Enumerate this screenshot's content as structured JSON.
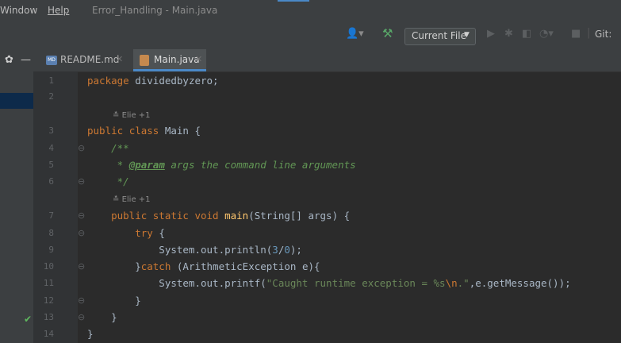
{
  "menu": {
    "window": "Window",
    "help": "Help",
    "title": "Error_Handling - Main.java"
  },
  "toolbar": {
    "run_config": "Current File",
    "git": "Git:"
  },
  "tabs": [
    {
      "label": "README.md"
    },
    {
      "label": "Main.java"
    }
  ],
  "hints": {
    "author1": "Elie +1",
    "author2": "Elie +1"
  },
  "line_numbers": [
    "1",
    "2",
    "3",
    "4",
    "5",
    "6",
    "7",
    "8",
    "9",
    "10",
    "11",
    "12",
    "13",
    "14"
  ],
  "code": {
    "l1_kw": "package",
    "l1_rest": " dividedbyzero;",
    "l3_kw1": "public",
    "l3_kw2": "class",
    "l3_rest": " Main {",
    "l4": "    /**",
    "l5_a": "     * ",
    "l5_tag": "@param",
    "l5_b": " args the command line arguments",
    "l6": "     */",
    "l7_kw": "    public static void",
    "l7_fn": " main",
    "l7_rest": "(String[] args) {",
    "l8_kw": "        try",
    "l8_rest": " {",
    "l9_a": "            System.out.println(",
    "l9_n1": "3",
    "l9_op": "/",
    "l9_n2": "0",
    "l9_b": ");",
    "l10_a": "        }",
    "l10_kw": "catch",
    "l10_b": " (ArithmeticException e){",
    "l11_a": "            System.out.printf(",
    "l11_s1": "\"Caught runtime exception = %s",
    "l11_esc": "\\n",
    "l11_s2": ".\"",
    "l11_b": ",e.getMessage());",
    "l12": "        }",
    "l13": "    }",
    "l14": "}"
  }
}
